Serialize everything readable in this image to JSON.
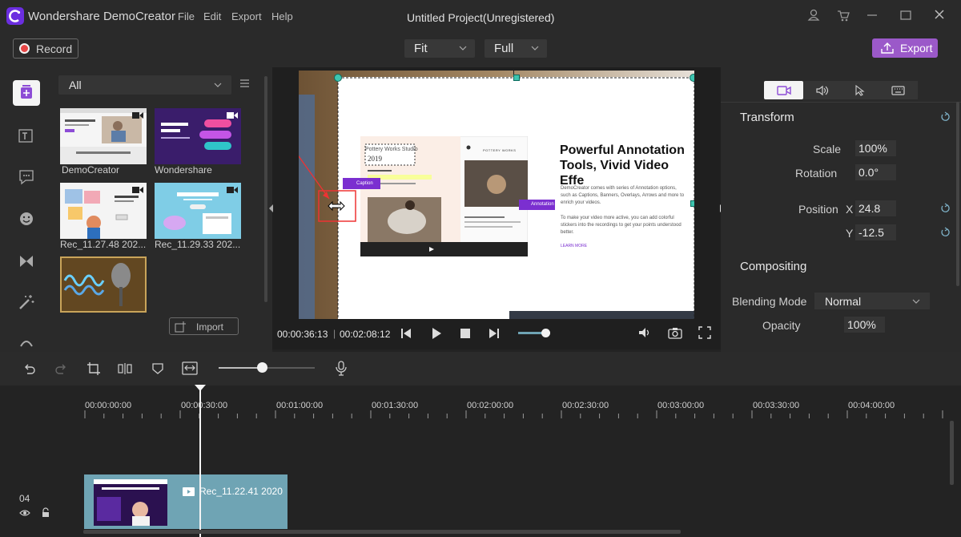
{
  "app": {
    "name": "Wondershare DemoCreator",
    "project_title": "Untitled Project(Unregistered)"
  },
  "menu": [
    "File",
    "Edit",
    "Export",
    "Help"
  ],
  "toolbar": {
    "record_label": "Record",
    "fit_label": "Fit",
    "full_label": "Full",
    "export_label": "Export"
  },
  "media": {
    "filter_label": "All",
    "import_label": "Import",
    "items": [
      {
        "label": "DemoCreator"
      },
      {
        "label": "Wondershare"
      },
      {
        "label": "Rec_11.27.48 202..."
      },
      {
        "label": "Rec_11.29.33 202..."
      },
      {
        "label": ""
      }
    ]
  },
  "preview": {
    "headline": "Powerful Annotation Tools, Vivid Video Effe",
    "body": "DemoCreator comes with series of Annotation options, such as Captions, Banners, Overlays, Arrows and more to enrich your videos.",
    "body2": "To make your video more active, you can add colorful stickers into the recordings to get your points understood better.",
    "learn_more": "LEARN MORE",
    "studio": "Pottery Works Studio",
    "studio_year": "2019",
    "caption_tag": "Caption",
    "annotation_tag": "Annotation",
    "pottery": "POTTERY WORKS"
  },
  "playback": {
    "current": "00:00:36:13",
    "separator": "|",
    "total": "00:02:08:12",
    "volume_fraction": 0.85
  },
  "properties": {
    "transform_title": "Transform",
    "scale_label": "Scale",
    "scale_value": "100%",
    "rotation_label": "Rotation",
    "rotation_value": "0.0°",
    "position_label": "Position",
    "x_label": "X",
    "x_value": "24.8",
    "y_label": "Y",
    "y_value": "-12.5",
    "compositing_title": "Compositing",
    "blend_label": "Blending Mode",
    "blend_value": "Normal",
    "opacity_label": "Opacity",
    "opacity_value": "100%"
  },
  "timeline": {
    "zoom_fraction": 0.45,
    "ticks": [
      "00:00:00:00",
      "00:00:30:00",
      "00:01:00:00",
      "00:01:30:00",
      "00:02:00:00",
      "00:02:30:00",
      "00:03:00:00",
      "00:03:30:00",
      "00:04:00:00"
    ],
    "track_number": "04",
    "clip_label": "Rec_11.22.41 2020",
    "clip_color": "#6fa4b4"
  },
  "colors": {
    "accent": "#9b59c9",
    "record_red": "#e64545",
    "handle": "#3ec5b0"
  }
}
